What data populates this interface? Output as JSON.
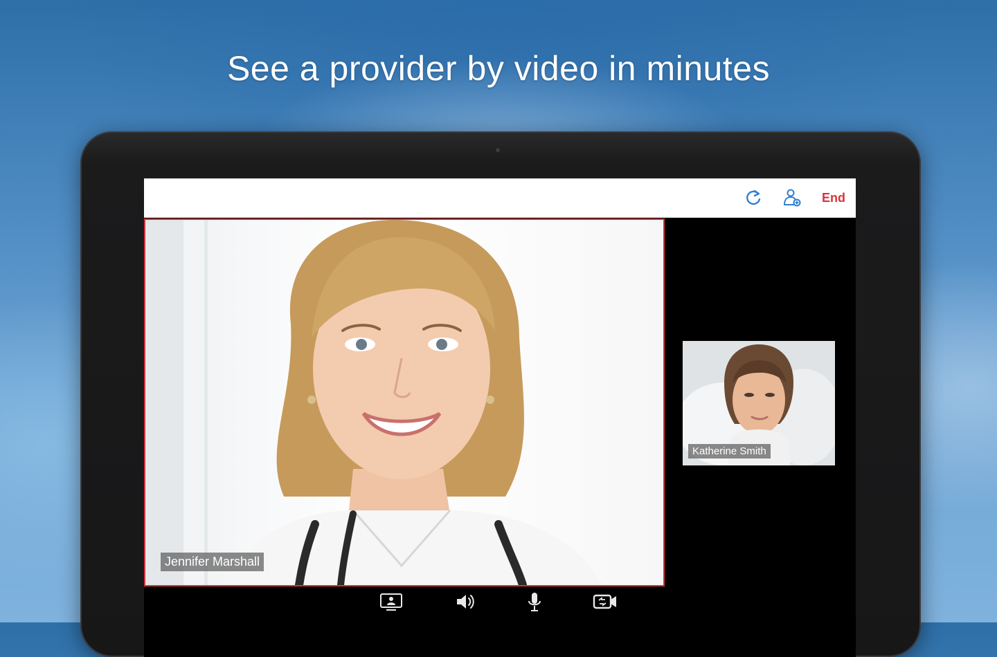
{
  "headline": "See a provider by video in minutes",
  "toolbar": {
    "refresh_icon": "refresh-icon",
    "provider_icon": "add-provider-icon",
    "end_label": "End"
  },
  "call": {
    "provider_name": "Jennifer Marshall",
    "patient_name": "Katherine Smith"
  },
  "controls": {
    "icons": [
      "share-screen-icon",
      "speaker-icon",
      "microphone-icon",
      "camera-switch-icon"
    ]
  },
  "colors": {
    "accent": "#d8323a",
    "icon_blue": "#2f7fd0",
    "screen_bg": "#000000",
    "tablet_bezel": "#1b1b1c"
  }
}
